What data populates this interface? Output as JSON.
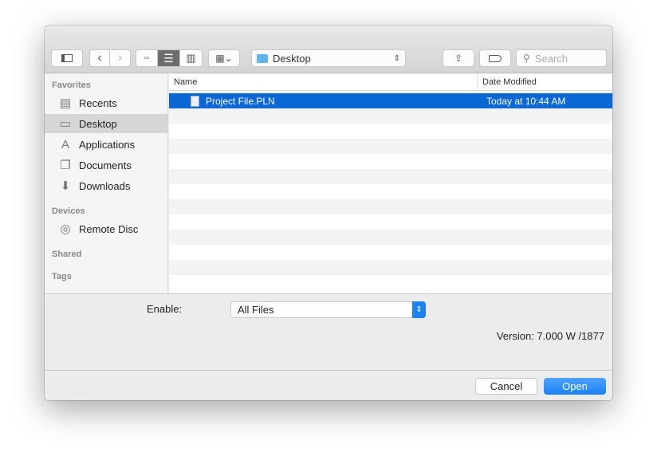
{
  "toolbar": {
    "location": "Desktop",
    "search_placeholder": "Search"
  },
  "sidebar": {
    "favorites_label": "Favorites",
    "favorites": [
      {
        "label": "Recents",
        "icon": "recents-icon"
      },
      {
        "label": "Desktop",
        "icon": "desktop-icon"
      },
      {
        "label": "Applications",
        "icon": "applications-icon"
      },
      {
        "label": "Documents",
        "icon": "documents-icon"
      },
      {
        "label": "Downloads",
        "icon": "downloads-icon"
      }
    ],
    "devices_label": "Devices",
    "devices": [
      {
        "label": "Remote Disc",
        "icon": "disc-icon"
      }
    ],
    "shared_label": "Shared",
    "tags_label": "Tags"
  },
  "list": {
    "columns": {
      "name": "Name",
      "date": "Date Modified"
    },
    "files": [
      {
        "name": "Project File.PLN",
        "date": "Today at 10:44 AM"
      }
    ]
  },
  "options": {
    "enable_label": "Enable:",
    "enable_value": "All Files",
    "version": "Version: 7.000 W /1877"
  },
  "buttons": {
    "cancel": "Cancel",
    "open": "Open"
  },
  "colors": {
    "selection": "#0a68d6",
    "accent": "#1a82f5"
  }
}
